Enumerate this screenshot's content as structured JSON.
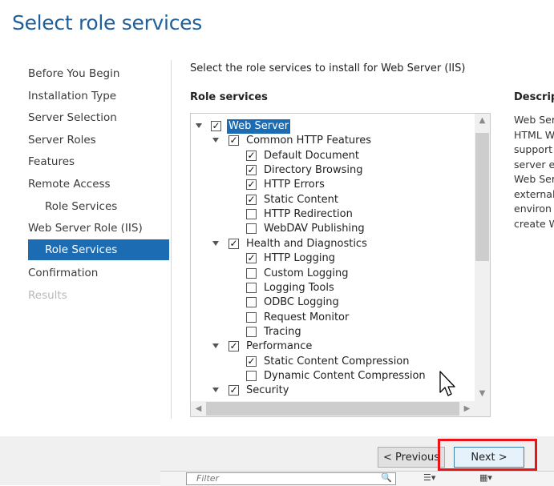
{
  "page_title": "Select role services",
  "nav": {
    "items": [
      {
        "label": "Before You Begin"
      },
      {
        "label": "Installation Type"
      },
      {
        "label": "Server Selection"
      },
      {
        "label": "Server Roles"
      },
      {
        "label": "Features"
      },
      {
        "label": "Remote Access"
      },
      {
        "label": "Role Services"
      },
      {
        "label": "Web Server Role (IIS)"
      },
      {
        "label": "Role Services"
      },
      {
        "label": "Confirmation"
      },
      {
        "label": "Results"
      }
    ],
    "selected_index": 8,
    "disabled_index": 10
  },
  "instruction": "Select the role services to install for Web Server (IIS)",
  "role_services_label": "Role services",
  "description_label": "Descript",
  "description_lines": [
    "Web Ser",
    "HTML W",
    "support",
    "server ex",
    "Web Ser",
    "external",
    "environ",
    "create W"
  ],
  "tree": [
    {
      "label": "Web Server",
      "level": 0,
      "expander": true,
      "checked": true,
      "selected": true
    },
    {
      "label": "Common HTTP Features",
      "level": 1,
      "expander": true,
      "checked": true
    },
    {
      "label": "Default Document",
      "level": 2,
      "checked": true
    },
    {
      "label": "Directory Browsing",
      "level": 2,
      "checked": true
    },
    {
      "label": "HTTP Errors",
      "level": 2,
      "checked": true
    },
    {
      "label": "Static Content",
      "level": 2,
      "checked": true
    },
    {
      "label": "HTTP Redirection",
      "level": 2,
      "checked": false
    },
    {
      "label": "WebDAV Publishing",
      "level": 2,
      "checked": false
    },
    {
      "label": "Health and Diagnostics",
      "level": 1,
      "expander": true,
      "checked": true
    },
    {
      "label": "HTTP Logging",
      "level": 2,
      "checked": true
    },
    {
      "label": "Custom Logging",
      "level": 2,
      "checked": false
    },
    {
      "label": "Logging Tools",
      "level": 2,
      "checked": false
    },
    {
      "label": "ODBC Logging",
      "level": 2,
      "checked": false
    },
    {
      "label": "Request Monitor",
      "level": 2,
      "checked": false
    },
    {
      "label": "Tracing",
      "level": 2,
      "checked": false
    },
    {
      "label": "Performance",
      "level": 1,
      "expander": true,
      "checked": true
    },
    {
      "label": "Static Content Compression",
      "level": 2,
      "checked": true
    },
    {
      "label": "Dynamic Content Compression",
      "level": 2,
      "checked": false
    },
    {
      "label": "Security",
      "level": 1,
      "expander": true,
      "checked": true
    }
  ],
  "buttons": {
    "previous": "< Previous",
    "next": "Next >"
  },
  "filter_placeholder": "Filter",
  "colors": {
    "accent": "#1c6cb4",
    "title": "#1f5f9a",
    "highlight": "#e8141a"
  }
}
